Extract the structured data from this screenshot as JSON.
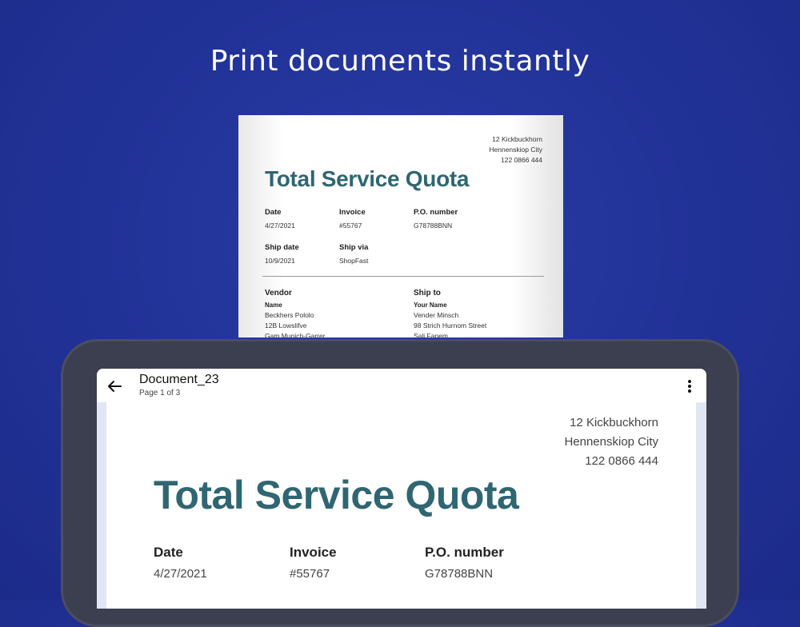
{
  "headline": "Print documents instantly",
  "document": {
    "address": [
      "12 Kickbuckhorn",
      "Hennenskiop City",
      "122 0866 444"
    ],
    "title": "Total Service Quota",
    "date_label": "Date",
    "date_value": "4/27/2021",
    "invoice_label": "Invoice",
    "invoice_value": "#55767",
    "po_label": "P.O. number",
    "po_value": "G78788BNN",
    "ship_date_label": "Ship date",
    "ship_date_value": "10/9/2021",
    "ship_via_label": "Ship via",
    "ship_via_value": "ShopFast",
    "vendor": {
      "heading": "Vendor",
      "name_label": "Name",
      "lines": [
        "Beckhers Pololo",
        "12B Lowslifve",
        "Gam Munich-Garrer"
      ]
    },
    "ship_to": {
      "heading": "Ship to",
      "name_label": "Your Name",
      "lines": [
        "Vender Minsch",
        "98 Strich Hurnom Street",
        "Sali Fanem"
      ]
    }
  },
  "viewer": {
    "doc_name": "Document_23",
    "page_info": "Page 1 of 3",
    "back_icon": "arrow-back-icon",
    "menu_icon": "more-vertical-icon"
  },
  "colors": {
    "background": "#223399",
    "title_teal": "#2f6672",
    "tablet_frame": "#3b3f50"
  }
}
